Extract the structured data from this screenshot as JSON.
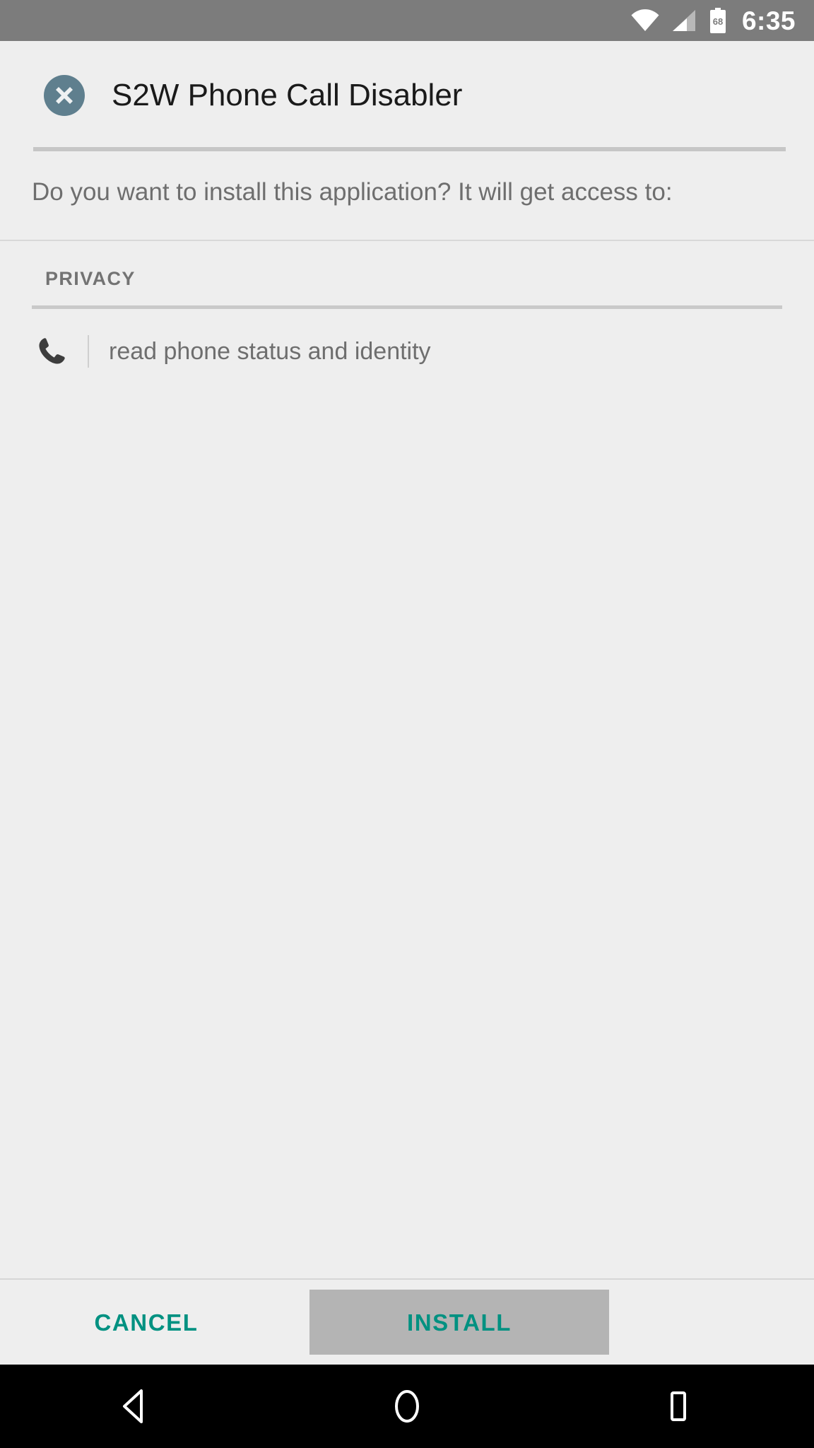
{
  "statusbar": {
    "time": "6:35",
    "battery_percent": "68",
    "wifi_icon": "wifi-icon",
    "signal_icon": "cellular-signal-icon",
    "battery_icon": "battery-icon"
  },
  "dialog": {
    "app_icon": "app-x-icon",
    "app_title": "S2W Phone Call Disabler",
    "prompt": "Do you want to install this application? It will get access to:",
    "section_label": "PRIVACY",
    "permissions": [
      {
        "icon": "phone-icon",
        "text": "read phone status and identity"
      }
    ]
  },
  "actions": {
    "cancel_label": "CANCEL",
    "install_label": "INSTALL",
    "accent_color": "#009181",
    "install_bg": "#b4b4b4"
  },
  "navbar": {
    "back_icon": "back-triangle-icon",
    "home_icon": "home-circle-icon",
    "recents_icon": "recents-square-icon"
  }
}
